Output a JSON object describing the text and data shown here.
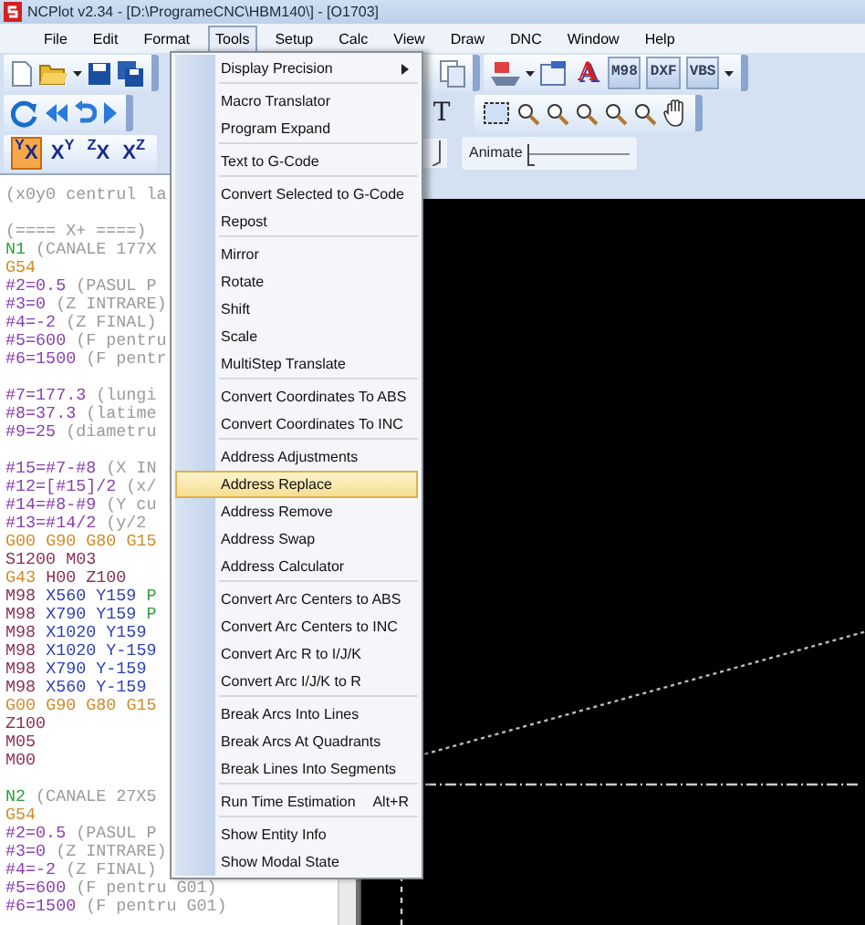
{
  "window": {
    "title": "NCPlot v2.34 - [D:\\ProgrameCNC\\HBM140\\] - [O1703]"
  },
  "menu_bar": [
    {
      "label": "File",
      "selected": false
    },
    {
      "label": "Edit",
      "selected": false
    },
    {
      "label": "Format",
      "selected": false
    },
    {
      "label": "Tools",
      "selected": true
    },
    {
      "label": "Setup",
      "selected": false
    },
    {
      "label": "Calc",
      "selected": false
    },
    {
      "label": "View",
      "selected": false
    },
    {
      "label": "Draw",
      "selected": false
    },
    {
      "label": "DNC",
      "selected": false
    },
    {
      "label": "Window",
      "selected": false
    },
    {
      "label": "Help",
      "selected": false
    }
  ],
  "toolbar": {
    "text_buttons": [
      "M98",
      "DXF",
      "VBS"
    ],
    "style_button": "A",
    "cut_button": "T",
    "view_buttons": [
      {
        "label": "$^{Y}$X",
        "selected": true
      },
      {
        "label": "X$^{Y}$",
        "selected": false
      },
      {
        "label": "$^{Z}$X",
        "selected": false
      },
      {
        "label": "X$^{Z}$",
        "selected": false
      }
    ],
    "animate": {
      "label": "Animate",
      "level": 0
    }
  },
  "editor": {
    "blocks": [
      [
        [
          {
            "text": "(x0y0 centrul la",
            "kind": "comment"
          }
        ]
      ],
      [
        [
          {
            "text": "(==== X+ ====)",
            "kind": "comment"
          }
        ],
        [
          {
            "text": "N1",
            "kind": "block"
          },
          {
            "text": "(CANALE 177X",
            "kind": "comment"
          }
        ],
        [
          {
            "text": "G54",
            "kind": "gcode"
          }
        ],
        [
          {
            "text": "#2=0.5",
            "kind": "variable"
          },
          {
            "text": "(PASUL P",
            "kind": "comment"
          }
        ],
        [
          {
            "text": "#3=0",
            "kind": "variable"
          },
          {
            "text": "(Z INTRARE)",
            "kind": "comment"
          }
        ],
        [
          {
            "text": "#4=-2",
            "kind": "variable"
          },
          {
            "text": "(Z FINAL)",
            "kind": "comment"
          }
        ],
        [
          {
            "text": "#5=600",
            "kind": "variable"
          },
          {
            "text": "(F pentru",
            "kind": "comment"
          }
        ],
        [
          {
            "text": "#6=1500",
            "kind": "variable"
          },
          {
            "text": "(F pentr",
            "kind": "comment"
          }
        ]
      ],
      [
        [
          {
            "text": "#7=177.3",
            "kind": "variable"
          },
          {
            "text": "(lungi",
            "kind": "comment"
          }
        ],
        [
          {
            "text": "#8=37.3",
            "kind": "variable"
          },
          {
            "text": "(latime",
            "kind": "comment"
          }
        ],
        [
          {
            "text": "#9=25",
            "kind": "variable"
          },
          {
            "text": "(diametru",
            "kind": "comment"
          }
        ]
      ],
      [
        [
          {
            "text": "#15=#7-#8",
            "kind": "variable"
          },
          {
            "text": "(X IN",
            "kind": "comment"
          }
        ],
        [
          {
            "text": "#12=[#15]/2",
            "kind": "variable"
          },
          {
            "text": "(x/",
            "kind": "comment"
          }
        ],
        [
          {
            "text": "#14=#8-#9",
            "kind": "variable"
          },
          {
            "text": "(Y cu",
            "kind": "comment"
          }
        ],
        [
          {
            "text": "#13=#14/2",
            "kind": "variable"
          },
          {
            "text": "(y/2",
            "kind": "comment"
          }
        ],
        [
          {
            "text": "G00",
            "kind": "gcode"
          },
          {
            "text": "G90",
            "kind": "gcode"
          },
          {
            "text": "G80",
            "kind": "gcode"
          },
          {
            "text": "G15",
            "kind": "gcode"
          }
        ],
        [
          {
            "text": "S1200",
            "kind": "word"
          },
          {
            "text": "M03",
            "kind": "word"
          }
        ],
        [
          {
            "text": "G43",
            "kind": "gcode"
          },
          {
            "text": "H00",
            "kind": "word"
          },
          {
            "text": "Z100",
            "kind": "word"
          }
        ],
        [
          {
            "text": "M98",
            "kind": "word"
          },
          {
            "text": "X560",
            "kind": "axis"
          },
          {
            "text": "Y159",
            "kind": "axis"
          },
          {
            "text": "P",
            "kind": "block"
          }
        ],
        [
          {
            "text": "M98",
            "kind": "word"
          },
          {
            "text": "X790",
            "kind": "axis"
          },
          {
            "text": "Y159",
            "kind": "axis"
          },
          {
            "text": "P",
            "kind": "block"
          }
        ],
        [
          {
            "text": "M98",
            "kind": "word"
          },
          {
            "text": "X1020",
            "kind": "axis"
          },
          {
            "text": "Y159",
            "kind": "axis"
          }
        ],
        [
          {
            "text": "M98",
            "kind": "word"
          },
          {
            "text": "X1020",
            "kind": "axis"
          },
          {
            "text": "Y-159",
            "kind": "axis"
          }
        ],
        [
          {
            "text": "M98",
            "kind": "word"
          },
          {
            "text": "X790",
            "kind": "axis"
          },
          {
            "text": "Y-159",
            "kind": "axis"
          }
        ],
        [
          {
            "text": "M98",
            "kind": "word"
          },
          {
            "text": "X560",
            "kind": "axis"
          },
          {
            "text": "Y-159",
            "kind": "axis"
          }
        ],
        [
          {
            "text": "G00",
            "kind": "gcode"
          },
          {
            "text": "G90",
            "kind": "gcode"
          },
          {
            "text": "G80",
            "kind": "gcode"
          },
          {
            "text": "G15",
            "kind": "gcode"
          }
        ],
        [
          {
            "text": "Z100",
            "kind": "word"
          }
        ],
        [
          {
            "text": "M05",
            "kind": "word"
          }
        ],
        [
          {
            "text": "M00",
            "kind": "word"
          }
        ]
      ],
      [
        [
          {
            "text": "N2",
            "kind": "block"
          },
          {
            "text": "(CANALE 27X5",
            "kind": "comment"
          }
        ],
        [
          {
            "text": "G54",
            "kind": "gcode"
          }
        ],
        [
          {
            "text": "#2=0.5",
            "kind": "variable"
          },
          {
            "text": "(PASUL P",
            "kind": "comment"
          }
        ],
        [
          {
            "text": "#3=0",
            "kind": "variable"
          },
          {
            "text": "(Z INTRARE)",
            "kind": "comment"
          }
        ],
        [
          {
            "text": "#4=-2",
            "kind": "variable"
          },
          {
            "text": "(Z FINAL)",
            "kind": "comment"
          }
        ],
        [
          {
            "text": "#5=600",
            "kind": "variable"
          },
          {
            "text": "(F pentru G01)",
            "kind": "comment"
          }
        ],
        [
          {
            "text": "#6=1500",
            "kind": "variable"
          },
          {
            "text": "(F pentru G01)",
            "kind": "comment"
          }
        ]
      ]
    ]
  },
  "tools_menu": {
    "items": [
      {
        "kind": "item",
        "label": "Display Precision",
        "selected": false,
        "has_submenu": true
      },
      {
        "kind": "separator"
      },
      {
        "kind": "item",
        "label": "Macro Translator",
        "selected": false,
        "has_submenu": false
      },
      {
        "kind": "item",
        "label": "Program Expand",
        "selected": false,
        "has_submenu": false
      },
      {
        "kind": "separator"
      },
      {
        "kind": "item",
        "label": "Text to G-Code",
        "selected": false,
        "has_submenu": false
      },
      {
        "kind": "separator"
      },
      {
        "kind": "item",
        "label": "Convert Selected to G-Code",
        "selected": false,
        "has_submenu": false
      },
      {
        "kind": "item",
        "label": "Repost",
        "selected": false,
        "has_submenu": false
      },
      {
        "kind": "separator"
      },
      {
        "kind": "item",
        "label": "Mirror",
        "selected": false,
        "has_submenu": false
      },
      {
        "kind": "item",
        "label": "Rotate",
        "selected": false,
        "has_submenu": false
      },
      {
        "kind": "item",
        "label": "Shift",
        "selected": false,
        "has_submenu": false
      },
      {
        "kind": "item",
        "label": "Scale",
        "selected": false,
        "has_submenu": false
      },
      {
        "kind": "item",
        "label": "MultiStep Translate",
        "selected": false,
        "has_submenu": false
      },
      {
        "kind": "separator"
      },
      {
        "kind": "item",
        "label": "Convert Coordinates To ABS",
        "selected": false,
        "has_submenu": false
      },
      {
        "kind": "item",
        "label": "Convert Coordinates To INC",
        "selected": false,
        "has_submenu": false
      },
      {
        "kind": "separator"
      },
      {
        "kind": "item",
        "label": "Address Adjustments",
        "selected": false,
        "has_submenu": false
      },
      {
        "kind": "item",
        "label": "Address Replace",
        "selected": true,
        "has_submenu": false
      },
      {
        "kind": "item",
        "label": "Address Remove",
        "selected": false,
        "has_submenu": false
      },
      {
        "kind": "item",
        "label": "Address Swap",
        "selected": false,
        "has_submenu": false
      },
      {
        "kind": "item",
        "label": "Address Calculator",
        "selected": false,
        "has_submenu": false
      },
      {
        "kind": "separator"
      },
      {
        "kind": "item",
        "label": "Convert Arc Centers to ABS",
        "selected": false,
        "has_submenu": false
      },
      {
        "kind": "item",
        "label": "Convert Arc Centers to INC",
        "selected": false,
        "has_submenu": false
      },
      {
        "kind": "item",
        "label": "Convert Arc R to I/J/K",
        "selected": false,
        "has_submenu": false
      },
      {
        "kind": "item",
        "label": "Convert Arc I/J/K to R",
        "selected": false,
        "has_submenu": false
      },
      {
        "kind": "separator"
      },
      {
        "kind": "item",
        "label": "Break Arcs Into Lines",
        "selected": false,
        "has_submenu": false
      },
      {
        "kind": "item",
        "label": "Break Arcs At Quadrants",
        "selected": false,
        "has_submenu": false
      },
      {
        "kind": "item",
        "label": "Break Lines Into Segments",
        "selected": false,
        "has_submenu": false
      },
      {
        "kind": "separator"
      },
      {
        "kind": "item",
        "label": "Run Time Estimation",
        "selected": false,
        "has_submenu": false,
        "shortcut": "Alt+R"
      },
      {
        "kind": "separator"
      },
      {
        "kind": "item",
        "label": "Show Entity Info",
        "selected": false,
        "has_submenu": false
      },
      {
        "kind": "item",
        "label": "Show Modal State",
        "selected": false,
        "has_submenu": false
      }
    ]
  }
}
